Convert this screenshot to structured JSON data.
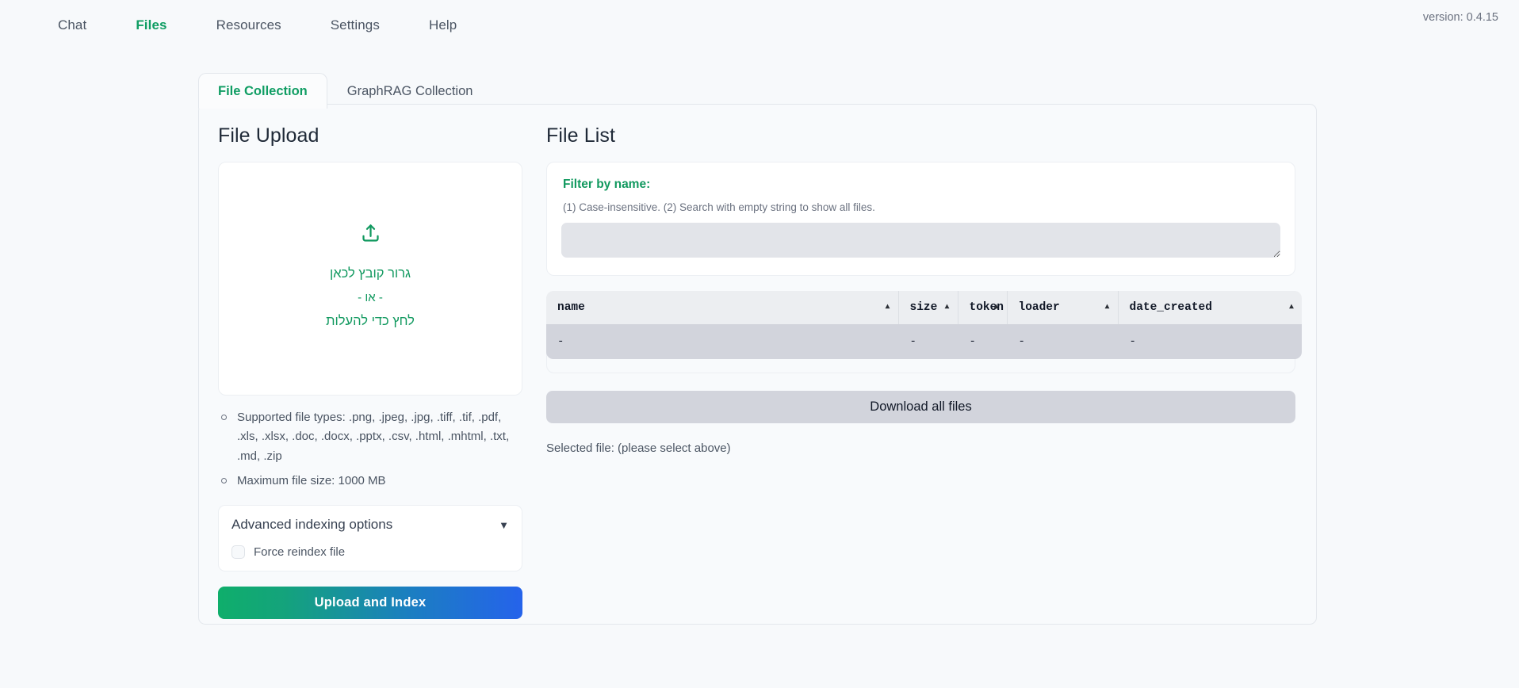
{
  "topnav": {
    "items": [
      {
        "label": "Chat",
        "active": false
      },
      {
        "label": "Files",
        "active": true
      },
      {
        "label": "Resources",
        "active": false
      },
      {
        "label": "Settings",
        "active": false
      },
      {
        "label": "Help",
        "active": false
      }
    ],
    "version": "version: 0.4.15"
  },
  "tabs": [
    {
      "label": "File Collection",
      "active": true
    },
    {
      "label": "GraphRAG Collection",
      "active": false
    }
  ],
  "upload": {
    "title": "File Upload",
    "dropzone": {
      "icon": "upload-icon",
      "drag_text": "גרור קובץ לכאן",
      "or_text": "- או -",
      "click_text": "לחץ כדי להעלות"
    },
    "notes": [
      "Supported file types: .png, .jpeg, .jpg, .tiff, .tif, .pdf, .xls, .xlsx, .doc, .docx, .pptx, .csv, .html, .mhtml, .txt, .md, .zip",
      "Maximum file size: 1000 MB"
    ],
    "advanced": {
      "label": "Advanced indexing options",
      "caret": "▼",
      "checkbox_label": "Force reindex file",
      "checkbox_checked": false
    },
    "submit_label": "Upload and Index"
  },
  "filelist": {
    "title": "File List",
    "filter": {
      "label": "Filter by name:",
      "hint": "(1) Case-insensitive. (2) Search with empty string to show all files.",
      "value": "",
      "placeholder": ""
    },
    "table": {
      "columns": [
        {
          "label": "name",
          "sort": "▲"
        },
        {
          "label": "size",
          "sort": "▲"
        },
        {
          "label": "token",
          "sort": "▲"
        },
        {
          "label": "loader",
          "sort": "▲"
        },
        {
          "label": "date_created",
          "sort": "▲"
        }
      ],
      "rows": [
        {
          "name": "-",
          "size": "-",
          "token": "-",
          "loader": "-",
          "date_created": "-"
        }
      ]
    },
    "download_label": "Download all files",
    "selected_file": "Selected file: (please select above)"
  },
  "colors": {
    "accent_green": "#11995f",
    "accent_blue": "#2563eb",
    "page_bg": "#f7f9fb",
    "panel_bg": "#f8fafc",
    "row_bg": "#d2d4dc"
  }
}
